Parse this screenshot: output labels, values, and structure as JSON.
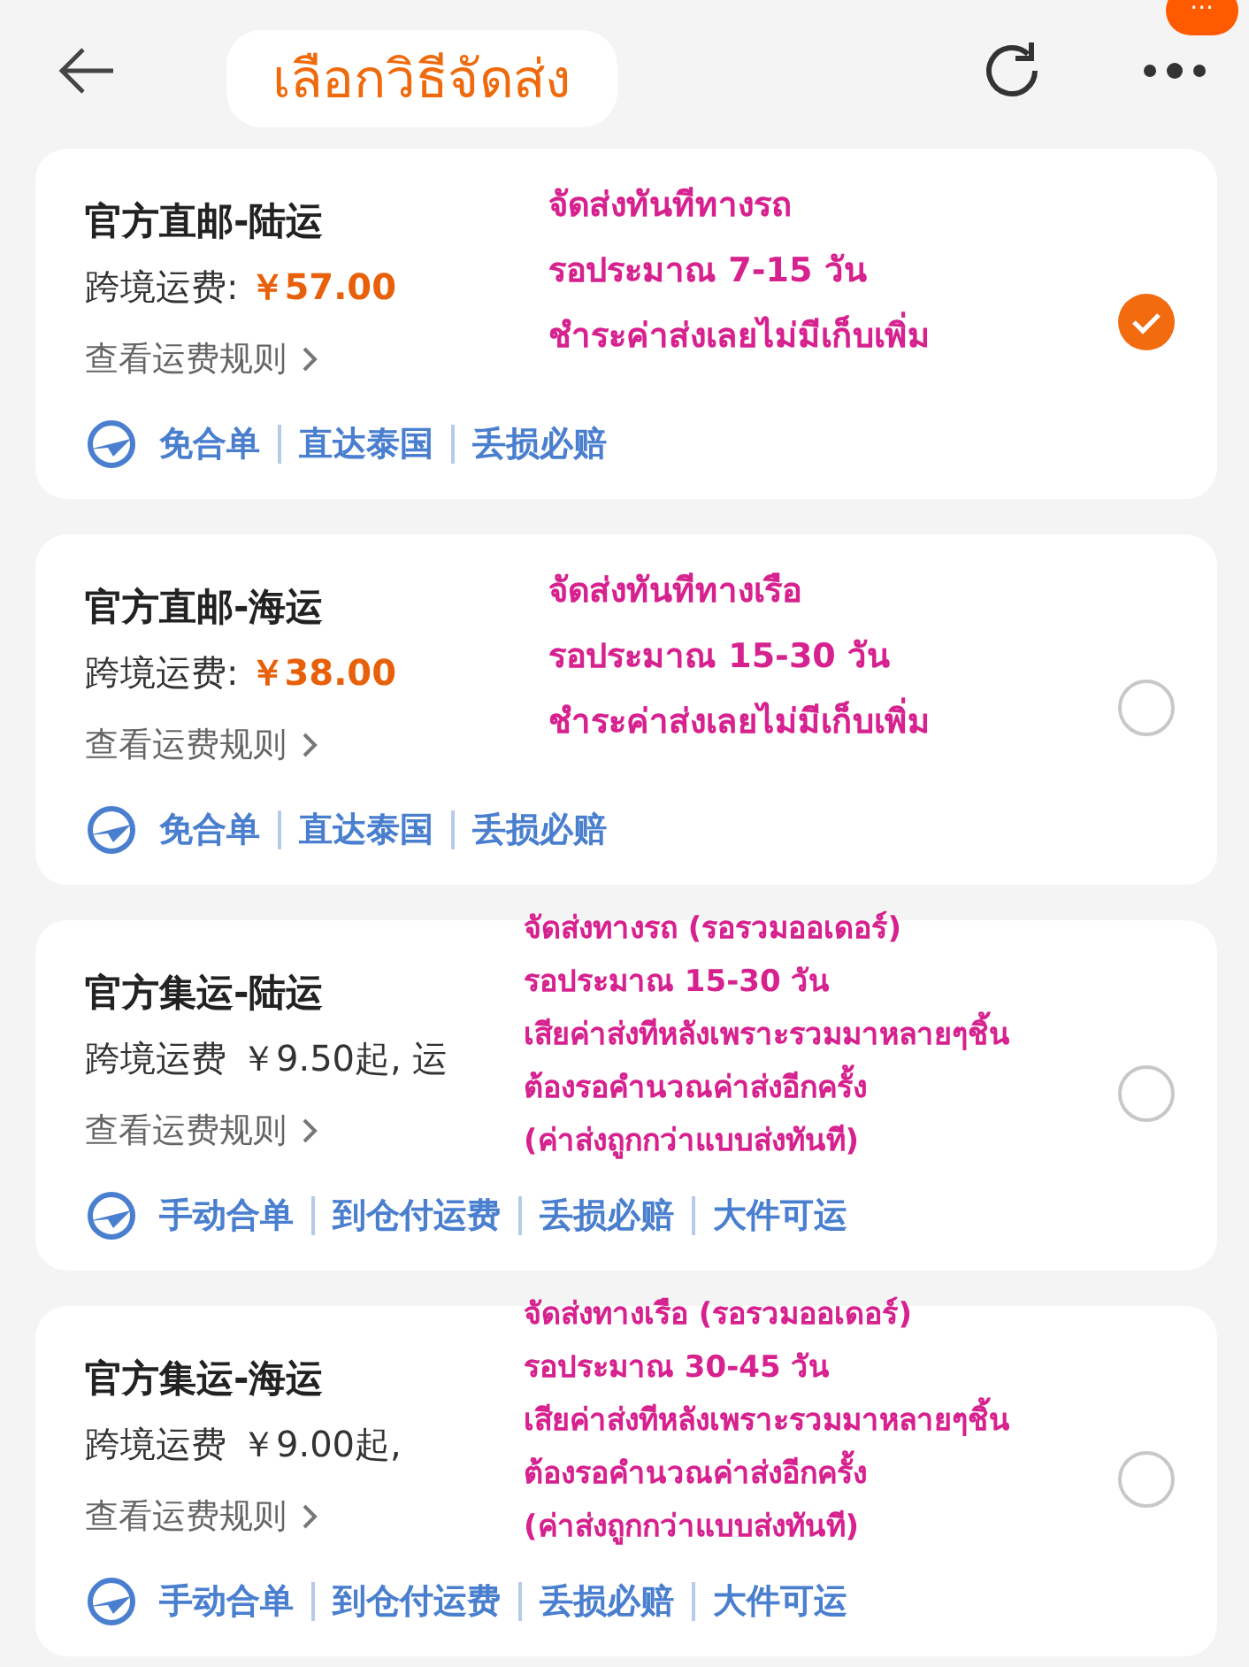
{
  "header": {
    "title": "เลือกวิธีจัดส่ง",
    "badge": "···"
  },
  "options": [
    {
      "name": "官方直邮-陆运",
      "fee": {
        "label": "跨境运费:",
        "value": "￥57.00",
        "highlighted": true
      },
      "rules_link": "查看运费规则",
      "tags": [
        "免合单",
        "直达泰国",
        "丢损必赔"
      ],
      "note": [
        "จัดส่งทันทีทางรถ",
        "รอประมาณ 7-15 วัน",
        "ชำระค่าส่งเลยไม่มีเก็บเพิ่ม"
      ],
      "selected": true
    },
    {
      "name": "官方直邮-海运",
      "fee": {
        "label": "跨境运费:",
        "value": "￥38.00",
        "highlighted": true
      },
      "rules_link": "查看运费规则",
      "tags": [
        "免合单",
        "直达泰国",
        "丢损必赔"
      ],
      "note": [
        "จัดส่งทันทีทางเรือ",
        "รอประมาณ 15-30 วัน",
        "ชำระค่าส่งเลยไม่มีเก็บเพิ่ม"
      ],
      "selected": false
    },
    {
      "name": "官方集运-陆运",
      "fee": {
        "label": "跨境运费",
        "value": "￥9.50起, 运",
        "highlighted": false
      },
      "rules_link": "查看运费规则",
      "tags": [
        "手动合单",
        "到仓付运费",
        "丢损必赔",
        "大件可运"
      ],
      "note": [
        "จัดส่งทางรถ (รอรวมออเดอร์)",
        "รอประมาณ 15-30 วัน",
        "เสียค่าส่งทีหลังเพราะรวมมาหลายๆชิ้น",
        "ต้องรอคำนวณค่าส่งอีกครั้ง",
        "(ค่าส่งถูกกว่าแบบส่งทันที)"
      ],
      "selected": false
    },
    {
      "name": "官方集运-海运",
      "fee": {
        "label": "跨境运费",
        "value": "￥9.00起,",
        "highlighted": false
      },
      "rules_link": "查看运费规则",
      "tags": [
        "手动合单",
        "到仓付运费",
        "丢损必赔",
        "大件可运"
      ],
      "note": [
        "จัดส่งทางเรือ (รอรวมออเดอร์)",
        "รอประมาณ 30-45 วัน",
        "เสียค่าส่งทีหลังเพราะรวมมาหลายๆชิ้น",
        "ต้องรอคำนวณค่าส่งอีกครั้ง",
        "(ค่าส่งถูกกว่าแบบส่งทันที)"
      ],
      "selected": false
    }
  ]
}
